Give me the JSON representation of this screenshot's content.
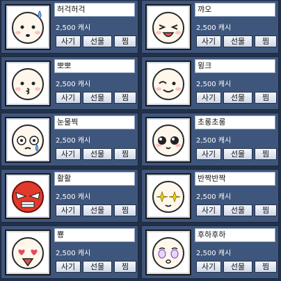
{
  "items": [
    {
      "name": "허걱허걱",
      "price": "2,500 캐시",
      "buy": "사기",
      "gift": "선물",
      "wish": "찜",
      "icon": "sweat-emoticon-icon"
    },
    {
      "name": "꺄오",
      "price": "2,500 캐시",
      "buy": "사기",
      "gift": "선물",
      "wish": "찜",
      "icon": "excited-emoticon-icon"
    },
    {
      "name": "뽀뽀",
      "price": "2,500 캐시",
      "buy": "사기",
      "gift": "선물",
      "wish": "찜",
      "icon": "kiss-emoticon-icon"
    },
    {
      "name": "윙크",
      "price": "2,500 캐시",
      "buy": "사기",
      "gift": "선물",
      "wish": "찜",
      "icon": "wink-emoticon-icon"
    },
    {
      "name": "눈물찍",
      "price": "2,500 캐시",
      "buy": "사기",
      "gift": "선물",
      "wish": "찜",
      "icon": "tear-emoticon-icon"
    },
    {
      "name": "초롱초롱",
      "price": "2,500 캐시",
      "buy": "사기",
      "gift": "선물",
      "wish": "찜",
      "icon": "sparkle-eyes-emoticon-icon"
    },
    {
      "name": "활활",
      "price": "2,500 캐시",
      "buy": "사기",
      "gift": "선물",
      "wish": "찜",
      "icon": "angry-emoticon-icon"
    },
    {
      "name": "반짝반짝",
      "price": "2,500 캐시",
      "buy": "사기",
      "gift": "선물",
      "wish": "찜",
      "icon": "twinkle-emoticon-icon"
    },
    {
      "name": "뿅",
      "price": "2,500 캐시",
      "buy": "사기",
      "gift": "선물",
      "wish": "찜",
      "icon": "love-emoticon-icon"
    },
    {
      "name": "후하후하",
      "price": "2,500 캐시",
      "buy": "사기",
      "gift": "선물",
      "wish": "찜",
      "icon": "breathing-emoticon-icon"
    }
  ]
}
